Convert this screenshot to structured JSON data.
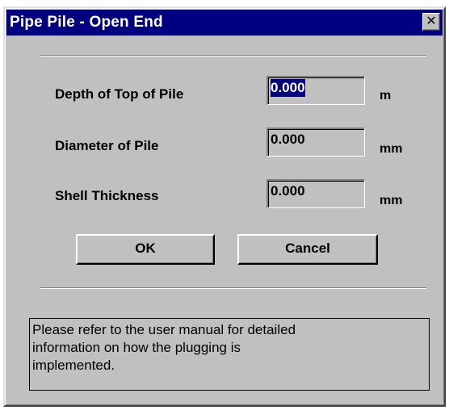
{
  "window": {
    "title": "Pipe Pile - Open End",
    "close_glyph": "✕"
  },
  "fields": [
    {
      "label": "Depth of Top of Pile",
      "value": "0.000",
      "unit": "m",
      "selected": true
    },
    {
      "label": "Diameter of Pile",
      "value": "0.000",
      "unit": "mm",
      "selected": false
    },
    {
      "label": "Shell Thickness",
      "value": "0.000",
      "unit": "mm",
      "selected": false
    }
  ],
  "buttons": {
    "ok_label": "OK",
    "cancel_label": "Cancel"
  },
  "info": {
    "text": "Please refer to the user manual for detailed\ninformation on how the plugging is\nimplemented."
  },
  "colors": {
    "titlebar": "#000080",
    "dialog_face": "#c0c0c0",
    "selection": "#000080"
  }
}
